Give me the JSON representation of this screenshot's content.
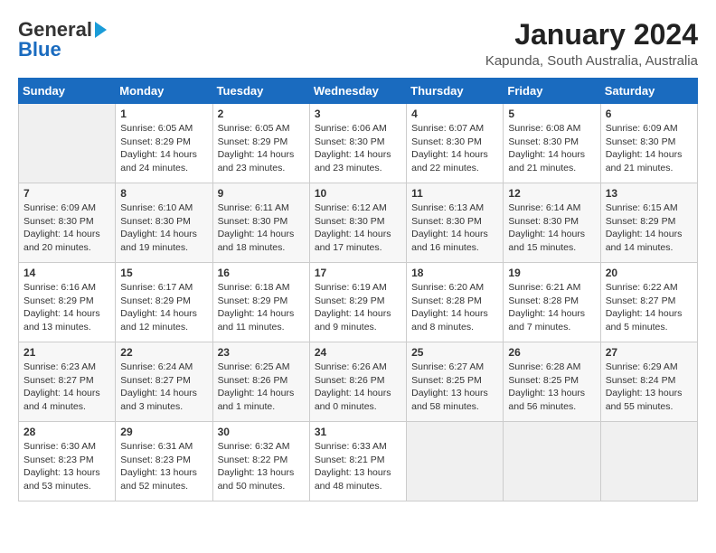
{
  "header": {
    "logo_line1": "General",
    "logo_line2": "Blue",
    "title": "January 2024",
    "subtitle": "Kapunda, South Australia, Australia"
  },
  "days_of_week": [
    "Sunday",
    "Monday",
    "Tuesday",
    "Wednesday",
    "Thursday",
    "Friday",
    "Saturday"
  ],
  "weeks": [
    [
      {
        "num": "",
        "info": ""
      },
      {
        "num": "1",
        "info": "Sunrise: 6:05 AM\nSunset: 8:29 PM\nDaylight: 14 hours\nand 24 minutes."
      },
      {
        "num": "2",
        "info": "Sunrise: 6:05 AM\nSunset: 8:29 PM\nDaylight: 14 hours\nand 23 minutes."
      },
      {
        "num": "3",
        "info": "Sunrise: 6:06 AM\nSunset: 8:30 PM\nDaylight: 14 hours\nand 23 minutes."
      },
      {
        "num": "4",
        "info": "Sunrise: 6:07 AM\nSunset: 8:30 PM\nDaylight: 14 hours\nand 22 minutes."
      },
      {
        "num": "5",
        "info": "Sunrise: 6:08 AM\nSunset: 8:30 PM\nDaylight: 14 hours\nand 21 minutes."
      },
      {
        "num": "6",
        "info": "Sunrise: 6:09 AM\nSunset: 8:30 PM\nDaylight: 14 hours\nand 21 minutes."
      }
    ],
    [
      {
        "num": "7",
        "info": "Sunrise: 6:09 AM\nSunset: 8:30 PM\nDaylight: 14 hours\nand 20 minutes."
      },
      {
        "num": "8",
        "info": "Sunrise: 6:10 AM\nSunset: 8:30 PM\nDaylight: 14 hours\nand 19 minutes."
      },
      {
        "num": "9",
        "info": "Sunrise: 6:11 AM\nSunset: 8:30 PM\nDaylight: 14 hours\nand 18 minutes."
      },
      {
        "num": "10",
        "info": "Sunrise: 6:12 AM\nSunset: 8:30 PM\nDaylight: 14 hours\nand 17 minutes."
      },
      {
        "num": "11",
        "info": "Sunrise: 6:13 AM\nSunset: 8:30 PM\nDaylight: 14 hours\nand 16 minutes."
      },
      {
        "num": "12",
        "info": "Sunrise: 6:14 AM\nSunset: 8:30 PM\nDaylight: 14 hours\nand 15 minutes."
      },
      {
        "num": "13",
        "info": "Sunrise: 6:15 AM\nSunset: 8:29 PM\nDaylight: 14 hours\nand 14 minutes."
      }
    ],
    [
      {
        "num": "14",
        "info": "Sunrise: 6:16 AM\nSunset: 8:29 PM\nDaylight: 14 hours\nand 13 minutes."
      },
      {
        "num": "15",
        "info": "Sunrise: 6:17 AM\nSunset: 8:29 PM\nDaylight: 14 hours\nand 12 minutes."
      },
      {
        "num": "16",
        "info": "Sunrise: 6:18 AM\nSunset: 8:29 PM\nDaylight: 14 hours\nand 11 minutes."
      },
      {
        "num": "17",
        "info": "Sunrise: 6:19 AM\nSunset: 8:29 PM\nDaylight: 14 hours\nand 9 minutes."
      },
      {
        "num": "18",
        "info": "Sunrise: 6:20 AM\nSunset: 8:28 PM\nDaylight: 14 hours\nand 8 minutes."
      },
      {
        "num": "19",
        "info": "Sunrise: 6:21 AM\nSunset: 8:28 PM\nDaylight: 14 hours\nand 7 minutes."
      },
      {
        "num": "20",
        "info": "Sunrise: 6:22 AM\nSunset: 8:27 PM\nDaylight: 14 hours\nand 5 minutes."
      }
    ],
    [
      {
        "num": "21",
        "info": "Sunrise: 6:23 AM\nSunset: 8:27 PM\nDaylight: 14 hours\nand 4 minutes."
      },
      {
        "num": "22",
        "info": "Sunrise: 6:24 AM\nSunset: 8:27 PM\nDaylight: 14 hours\nand 3 minutes."
      },
      {
        "num": "23",
        "info": "Sunrise: 6:25 AM\nSunset: 8:26 PM\nDaylight: 14 hours\nand 1 minute."
      },
      {
        "num": "24",
        "info": "Sunrise: 6:26 AM\nSunset: 8:26 PM\nDaylight: 14 hours\nand 0 minutes."
      },
      {
        "num": "25",
        "info": "Sunrise: 6:27 AM\nSunset: 8:25 PM\nDaylight: 13 hours\nand 58 minutes."
      },
      {
        "num": "26",
        "info": "Sunrise: 6:28 AM\nSunset: 8:25 PM\nDaylight: 13 hours\nand 56 minutes."
      },
      {
        "num": "27",
        "info": "Sunrise: 6:29 AM\nSunset: 8:24 PM\nDaylight: 13 hours\nand 55 minutes."
      }
    ],
    [
      {
        "num": "28",
        "info": "Sunrise: 6:30 AM\nSunset: 8:23 PM\nDaylight: 13 hours\nand 53 minutes."
      },
      {
        "num": "29",
        "info": "Sunrise: 6:31 AM\nSunset: 8:23 PM\nDaylight: 13 hours\nand 52 minutes."
      },
      {
        "num": "30",
        "info": "Sunrise: 6:32 AM\nSunset: 8:22 PM\nDaylight: 13 hours\nand 50 minutes."
      },
      {
        "num": "31",
        "info": "Sunrise: 6:33 AM\nSunset: 8:21 PM\nDaylight: 13 hours\nand 48 minutes."
      },
      {
        "num": "",
        "info": ""
      },
      {
        "num": "",
        "info": ""
      },
      {
        "num": "",
        "info": ""
      }
    ]
  ]
}
